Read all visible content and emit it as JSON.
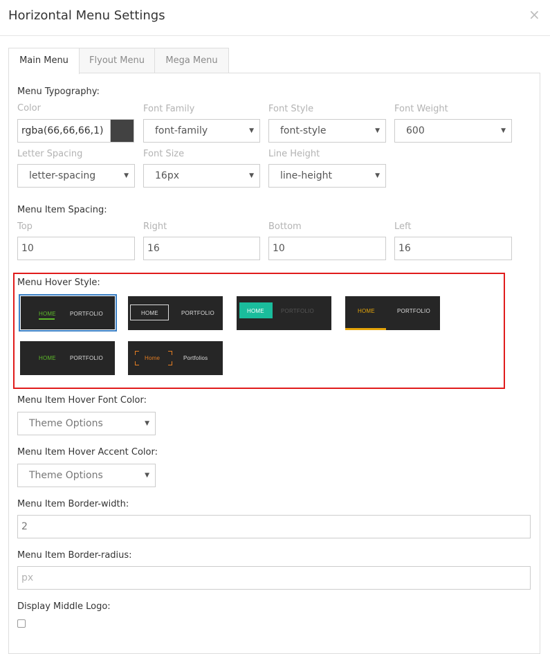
{
  "modal": {
    "title": "Horizontal Menu Settings",
    "close_symbol": "×"
  },
  "tabs": [
    {
      "label": "Main Menu",
      "active": true
    },
    {
      "label": "Flyout Menu",
      "active": false
    },
    {
      "label": "Mega Menu",
      "active": false
    }
  ],
  "typography": {
    "title": "Menu Typography:",
    "color": {
      "label": "Color",
      "value": "rgba(66,66,66,1)",
      "swatch": "#424242"
    },
    "font_family": {
      "label": "Font Family",
      "value": "font-family"
    },
    "font_style": {
      "label": "Font Style",
      "value": "font-style"
    },
    "font_weight": {
      "label": "Font Weight",
      "value": "600"
    },
    "letter_spacing": {
      "label": "Letter Spacing",
      "value": "letter-spacing"
    },
    "font_size": {
      "label": "Font Size",
      "value": "16px"
    },
    "line_height": {
      "label": "Line Height",
      "value": "line-height"
    }
  },
  "spacing": {
    "title": "Menu Item Spacing:",
    "top": {
      "label": "Top",
      "value": "10"
    },
    "right": {
      "label": "Right",
      "value": "16"
    },
    "bottom": {
      "label": "Bottom",
      "value": "10"
    },
    "left": {
      "label": "Left",
      "value": "16"
    }
  },
  "hover_style": {
    "title": "Menu Hover Style:",
    "highlight_color": "#e01b1b",
    "options": [
      {
        "home": "HOME",
        "portfolio": "PORTFOLIO",
        "selected": true,
        "accent": "#5dbb2a"
      },
      {
        "home": "HOME",
        "portfolio": "PORTFOLIO",
        "selected": false,
        "accent": "#dddddd"
      },
      {
        "home": "HOME",
        "portfolio": "PORTFOLIO",
        "selected": false,
        "accent": "#1abc9c"
      },
      {
        "home": "HOME",
        "portfolio": "PORTFOLIO",
        "selected": false,
        "accent": "#e5a50a"
      },
      {
        "home": "HOME",
        "portfolio": "PORTFOLIO",
        "selected": false,
        "accent": "#5dbb2a"
      },
      {
        "home": "Home",
        "portfolio": "Portfolios",
        "selected": false,
        "accent": "#e67e22"
      }
    ]
  },
  "hover_font_color": {
    "label": "Menu Item Hover Font Color:",
    "value": "Theme Options"
  },
  "hover_accent_color": {
    "label": "Menu Item Hover Accent Color:",
    "value": "Theme Options"
  },
  "border_width": {
    "label": "Menu Item Border-width:",
    "value": "2"
  },
  "border_radius": {
    "label": "Menu Item Border-radius:",
    "placeholder": "px"
  },
  "middle_logo": {
    "label": "Display Middle Logo:",
    "checked": false
  }
}
